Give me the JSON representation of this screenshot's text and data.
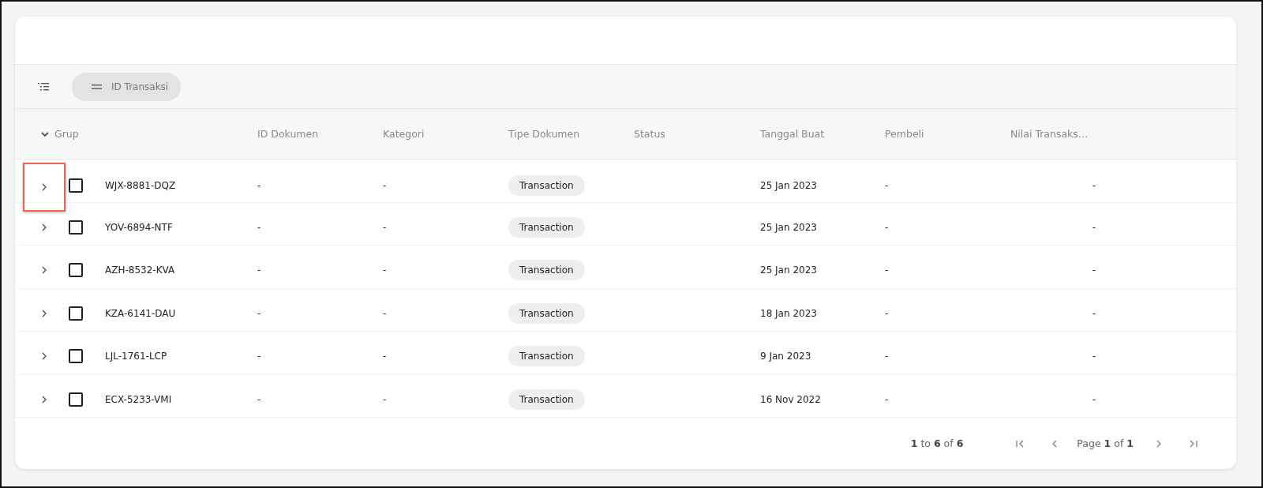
{
  "group_bar": {
    "chips": [
      {
        "label": "ID Transaksi"
      }
    ]
  },
  "table": {
    "group_column": {
      "label": "Grup",
      "expanded": true
    },
    "columns": [
      "ID Dokumen",
      "Kategori",
      "Tipe Dokumen",
      "Status",
      "Tanggal Buat",
      "Pembeli",
      "Nilai Transaks…"
    ],
    "rows": [
      {
        "group": "WJX-8881-DQZ",
        "expanded": false,
        "checked": false,
        "highlighted": true,
        "cells": [
          "-",
          "-",
          "Transaction",
          "",
          "25 Jan 2023",
          "-",
          "-"
        ]
      },
      {
        "group": "YOV-6894-NTF",
        "expanded": false,
        "checked": false,
        "highlighted": false,
        "cells": [
          "-",
          "-",
          "Transaction",
          "",
          "25 Jan 2023",
          "-",
          "-"
        ]
      },
      {
        "group": "AZH-8532-KVA",
        "expanded": false,
        "checked": false,
        "highlighted": false,
        "cells": [
          "-",
          "-",
          "Transaction",
          "",
          "25 Jan 2023",
          "-",
          "-"
        ]
      },
      {
        "group": "KZA-6141-DAU",
        "expanded": false,
        "checked": false,
        "highlighted": false,
        "cells": [
          "-",
          "-",
          "Transaction",
          "",
          "18 Jan 2023",
          "-",
          "-"
        ]
      },
      {
        "group": "LJL-1761-LCP",
        "expanded": false,
        "checked": false,
        "highlighted": false,
        "cells": [
          "-",
          "-",
          "Transaction",
          "",
          "9 Jan 2023",
          "-",
          "-"
        ]
      },
      {
        "group": "ECX-5233-VMI",
        "expanded": false,
        "checked": false,
        "highlighted": false,
        "cells": [
          "-",
          "-",
          "Transaction",
          "",
          "16 Nov 2022",
          "-",
          "-"
        ]
      }
    ]
  },
  "pagination": {
    "summary": "**1** to **6** of **6**",
    "page": "Page **1** of **1**"
  }
}
